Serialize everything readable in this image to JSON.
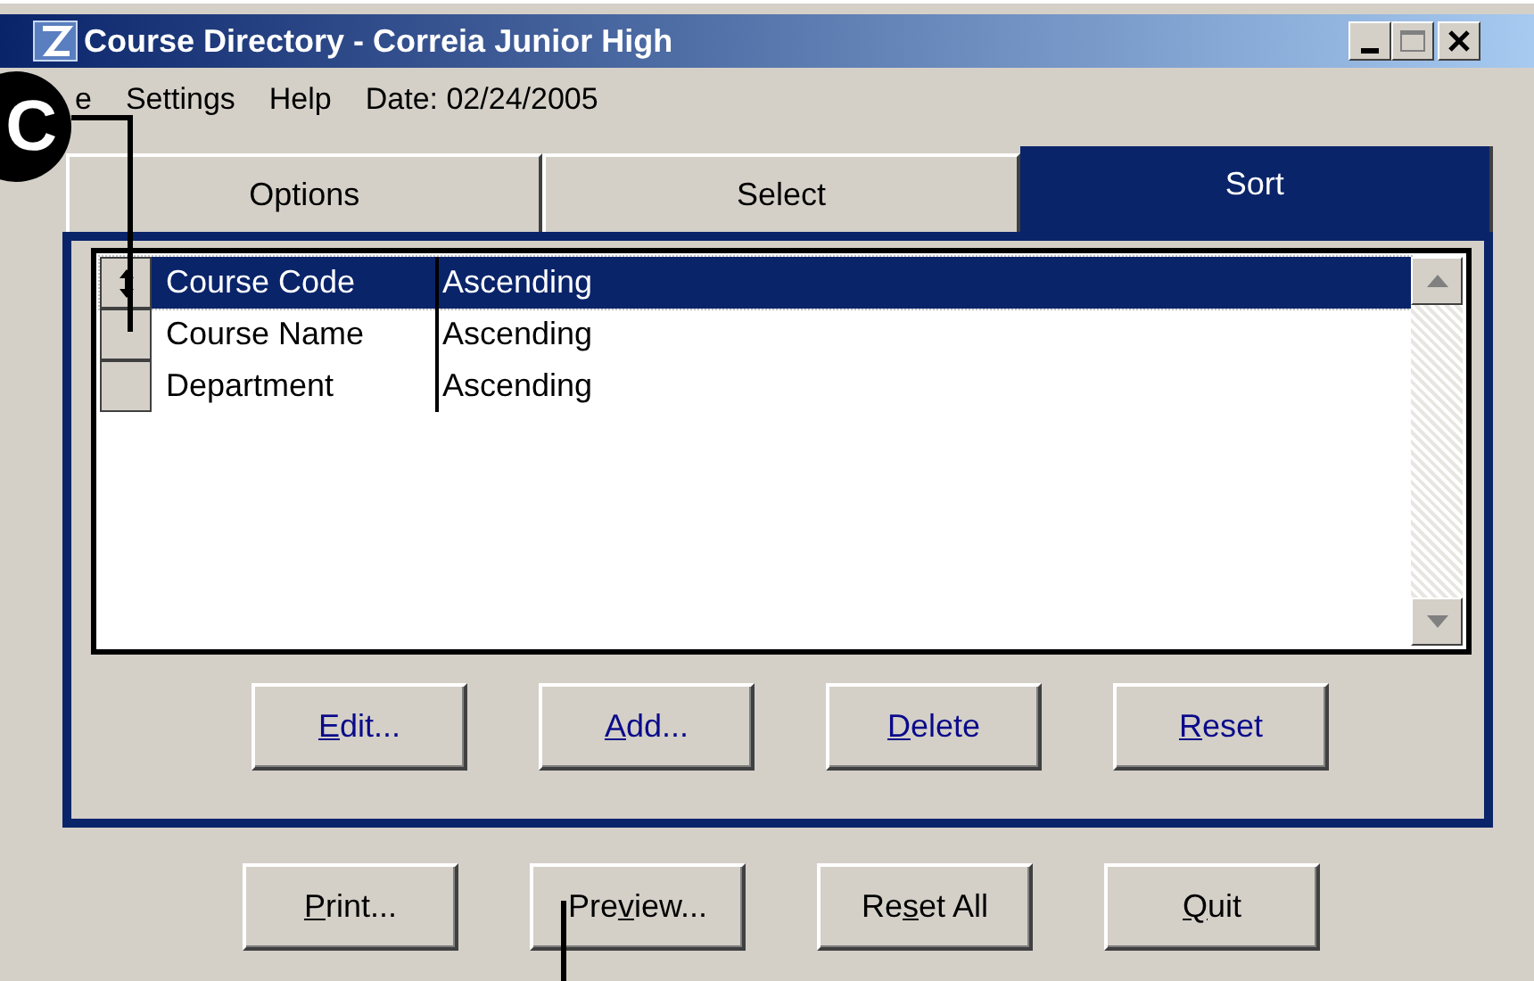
{
  "window": {
    "title": "Course Directory - Correia Junior High"
  },
  "menu": [
    {
      "label": "e"
    },
    {
      "label": "Settings"
    },
    {
      "label": "Help"
    },
    {
      "label": "Date: 02/24/2005"
    }
  ],
  "callout": {
    "label": "C"
  },
  "tabs": [
    {
      "label": "Options",
      "selected": false
    },
    {
      "label": "Select",
      "selected": false
    },
    {
      "label": "Sort",
      "selected": true
    }
  ],
  "sort_list": {
    "rows": [
      {
        "field": "Course Code",
        "order": "Ascending",
        "selected": true
      },
      {
        "field": "Course Name",
        "order": "Ascending",
        "selected": false
      },
      {
        "field": "Department",
        "order": "Ascending",
        "selected": false
      }
    ]
  },
  "panel_buttons": [
    {
      "mnemonic": "E",
      "after": "dit..."
    },
    {
      "mnemonic": "A",
      "after": "dd..."
    },
    {
      "mnemonic": "D",
      "after": "elete"
    },
    {
      "mnemonic": "R",
      "after": "eset"
    }
  ],
  "bottom_buttons": [
    {
      "mnemonic": "P",
      "after": "rint..."
    },
    {
      "before": "Pre",
      "mnemonic": "v",
      "after": "iew..."
    },
    {
      "before": "Re",
      "mnemonic": "s",
      "after": "et All"
    },
    {
      "mnemonic": "Q",
      "after": "uit"
    }
  ]
}
